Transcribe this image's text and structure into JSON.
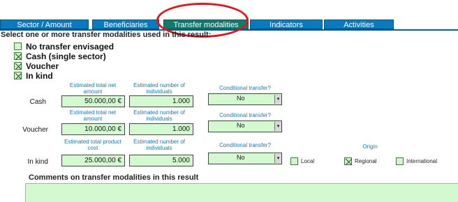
{
  "tabs": [
    {
      "label": "Sector / Amount"
    },
    {
      "label": "Beneficiaries"
    },
    {
      "label": "Transfer modalities"
    },
    {
      "label": "Indicators"
    },
    {
      "label": "Activities"
    }
  ],
  "instruction": "Select one or more transfer modalities used in this result:",
  "modalities": [
    {
      "label": "No transfer envisaged",
      "checked": false
    },
    {
      "label": "Cash (single sector)",
      "checked": true
    },
    {
      "label": "Voucher",
      "checked": true
    },
    {
      "label": "In kind",
      "checked": true
    }
  ],
  "cash": {
    "row_label": "Cash",
    "hdr_amount": "Estimated total net amount",
    "hdr_individuals": "Estimated number of individuals",
    "hdr_conditional": "Conditional transfer?",
    "amount": "50.000,00 €",
    "individuals": "1.000",
    "conditional": "No"
  },
  "voucher": {
    "row_label": "Voucher",
    "hdr_amount": "Estimated total net amount",
    "hdr_individuals": "Estimated number of individuals",
    "hdr_conditional": "Conditional transfer?",
    "amount": "10.000,00 €",
    "individuals": "1.000",
    "conditional": "No"
  },
  "inkind": {
    "row_label": "In kind",
    "hdr_amount": "Estimated total product cost",
    "hdr_individuals": "Estimated number of individuals",
    "hdr_conditional": "Conditional transfer?",
    "hdr_origin": "Origin",
    "amount": "25.000,00 €",
    "individuals": "5.000",
    "conditional": "No",
    "origin": [
      {
        "label": "Local",
        "checked": false
      },
      {
        "label": "Regional",
        "checked": true
      },
      {
        "label": "International",
        "checked": false
      }
    ]
  },
  "comments_title": "Comments on transfer modalities in this result",
  "comments_value": ""
}
